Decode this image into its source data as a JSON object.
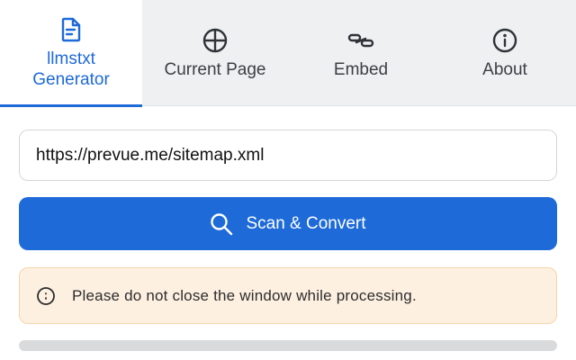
{
  "tabs": [
    {
      "label": "llmstxt\nGenerator",
      "icon": "document-icon",
      "active": true
    },
    {
      "label": "Current Page",
      "icon": "crosshair-circle-icon",
      "active": false
    },
    {
      "label": "Embed",
      "icon": "link-chain-icon",
      "active": false
    },
    {
      "label": "About",
      "icon": "info-icon",
      "active": false
    }
  ],
  "form": {
    "url_value": "https://prevue.me/sitemap.xml",
    "scan_button_label": "Scan & Convert",
    "scan_button_icon": "search-icon"
  },
  "notice": {
    "icon": "clock-icon",
    "text": "Please do not close the window while processing."
  },
  "progress": {
    "fraction": 0
  },
  "colors": {
    "accent": "#1d6ad8",
    "tab_bar_bg": "#eef0f2",
    "notice_bg": "#fdf0e1",
    "notice_border": "#f3d6ae",
    "progress_track": "#d9dadb"
  }
}
